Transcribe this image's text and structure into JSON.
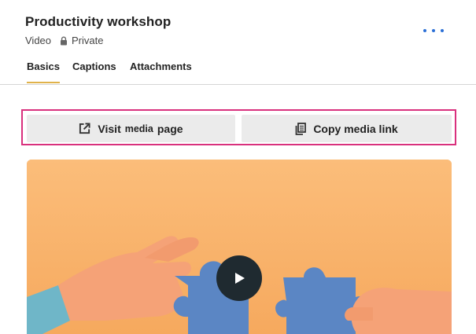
{
  "header": {
    "title": "Productivity workshop",
    "media_type": "Video",
    "visibility": "Private"
  },
  "tabs": [
    {
      "label": "Basics",
      "active": true
    },
    {
      "label": "Captions",
      "active": false
    },
    {
      "label": "Attachments",
      "active": false
    }
  ],
  "actions": {
    "visit_part1": "Visit",
    "visit_part2": "media",
    "visit_part3": "page",
    "copy_label": "Copy media link"
  },
  "colors": {
    "accent": "#2b6fd6",
    "tab_underline": "#e0b24a",
    "highlight_border": "#d9307d",
    "button_bg": "#ebebeb"
  },
  "icons": [
    "lock-icon",
    "more-options-icon",
    "external-link-icon",
    "copy-icon",
    "play-icon"
  ]
}
